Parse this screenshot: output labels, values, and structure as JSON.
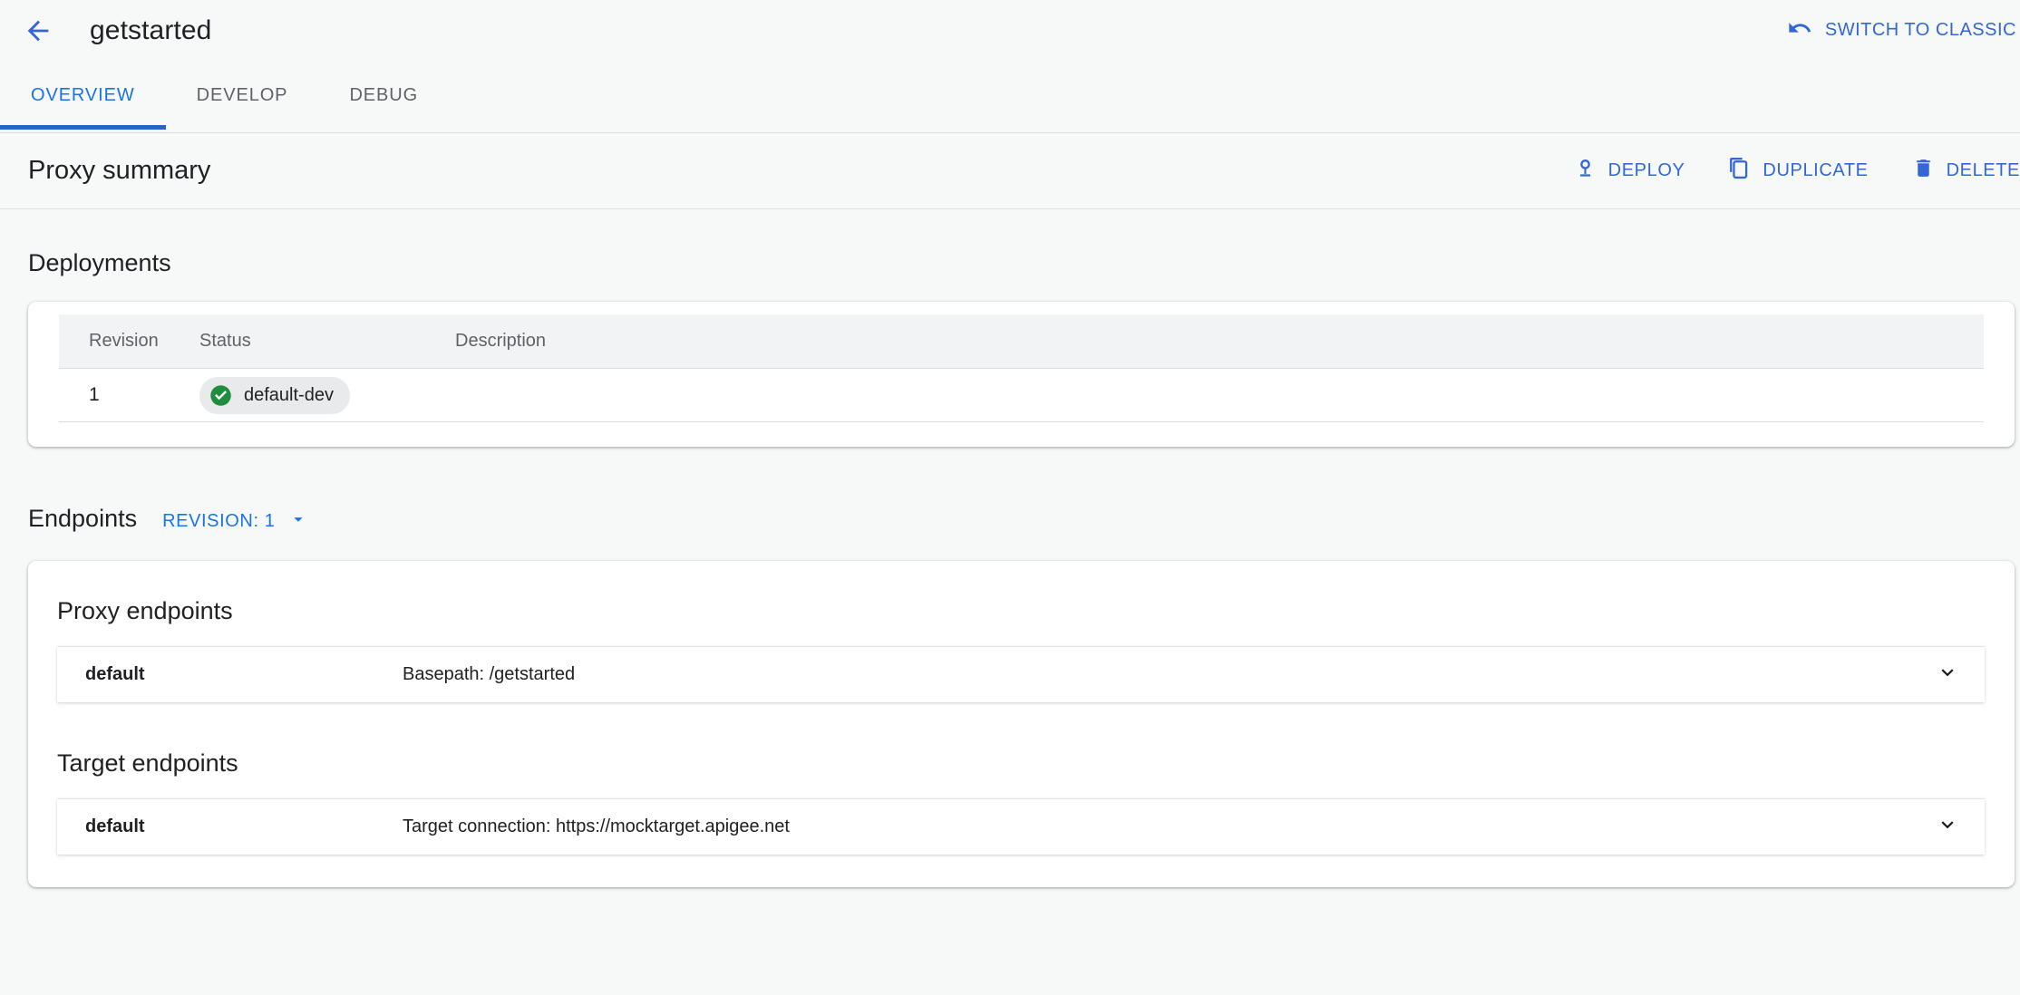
{
  "header": {
    "back_icon": "arrow-left-icon",
    "title": "getstarted",
    "switch_classic_label": "SWITCH TO CLASSIC",
    "switch_classic_icon": "undo-icon"
  },
  "tabs": [
    {
      "label": "OVERVIEW",
      "active": true
    },
    {
      "label": "DEVELOP",
      "active": false
    },
    {
      "label": "DEBUG",
      "active": false
    }
  ],
  "summary": {
    "title": "Proxy summary",
    "actions": [
      {
        "label": "DEPLOY",
        "icon": "deploy-pin-icon"
      },
      {
        "label": "DUPLICATE",
        "icon": "copy-icon"
      },
      {
        "label": "DELETE",
        "icon": "trash-icon"
      }
    ]
  },
  "deployments": {
    "heading": "Deployments",
    "columns": [
      "Revision",
      "Status",
      "Description"
    ],
    "rows": [
      {
        "revision": "1",
        "status": "default-dev",
        "status_icon": "check-circle-icon",
        "description": ""
      }
    ]
  },
  "endpoints": {
    "heading": "Endpoints",
    "revision_label": "REVISION: 1",
    "revision_icon": "chevron-down-icon",
    "groups": [
      {
        "title": "Proxy endpoints",
        "rows": [
          {
            "name": "default",
            "detail": "Basepath: /getstarted",
            "expand_icon": "chevron-down-icon"
          }
        ]
      },
      {
        "title": "Target endpoints",
        "rows": [
          {
            "name": "default",
            "detail": "Target connection: https://mocktarget.apigee.net",
            "expand_icon": "chevron-down-icon"
          }
        ]
      }
    ]
  },
  "colors": {
    "accent_blue": "#1a73e8",
    "link_blue": "#3367d6",
    "tab_underline": "#2a62cb",
    "status_green": "#1e8e3e",
    "page_bg": "#f7f8f8",
    "card_bg": "#ffffff",
    "table_header_bg": "#f1f3f4",
    "text_primary": "#202124",
    "text_secondary": "#5f6368",
    "divider": "#dadce0"
  }
}
